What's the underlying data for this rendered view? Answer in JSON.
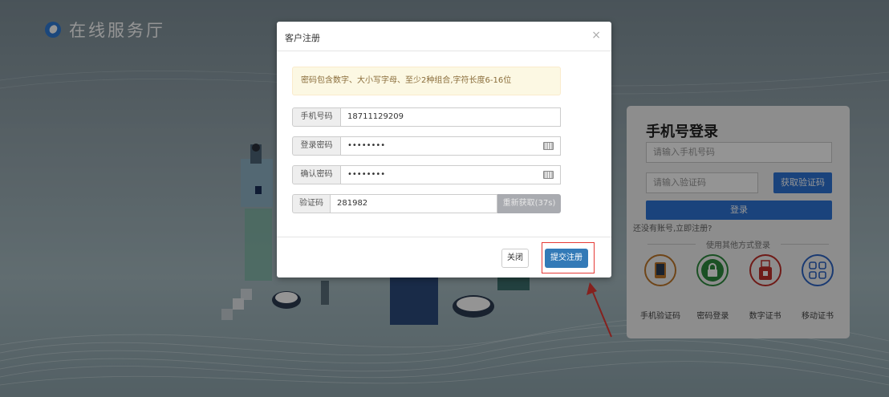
{
  "header": {
    "title": "在线服务厅"
  },
  "login": {
    "title": "手机号登录",
    "phone_placeholder": "请输入手机号码",
    "code_placeholder": "请输入验证码",
    "get_code_label": "获取验证码",
    "login_label": "登录",
    "register_link": "还没有账号,立即注册?",
    "other_methods_label": "使用其他方式登录",
    "methods": [
      {
        "label": "手机验证码",
        "icon": "phone-icon",
        "color": "#c0782a"
      },
      {
        "label": "密码登录",
        "icon": "lock-icon",
        "color": "#2e8b3e"
      },
      {
        "label": "数字证书",
        "icon": "usb-key-icon",
        "color": "#c0302a"
      },
      {
        "label": "移动证书",
        "icon": "qr-code-icon",
        "color": "#2e64c4"
      }
    ]
  },
  "modal": {
    "title": "客户注册",
    "close_symbol": "×",
    "alert": "密码包含数字、大小写字母、至少2种组合,字符长度6-16位",
    "fields": {
      "phone": {
        "label": "手机号码",
        "value": "18711129209"
      },
      "password": {
        "label": "登录密码",
        "value": "••••••••"
      },
      "confirm": {
        "label": "确认密码",
        "value": "••••••••"
      },
      "code": {
        "label": "验证码",
        "value": "281982",
        "resend_label": "重新获取(37s)"
      }
    },
    "close_label": "关闭",
    "submit_label": "提交注册"
  },
  "colors": {
    "primary": "#337ab7",
    "highlight": "#e53935",
    "alert_bg": "#fcf8e3"
  }
}
